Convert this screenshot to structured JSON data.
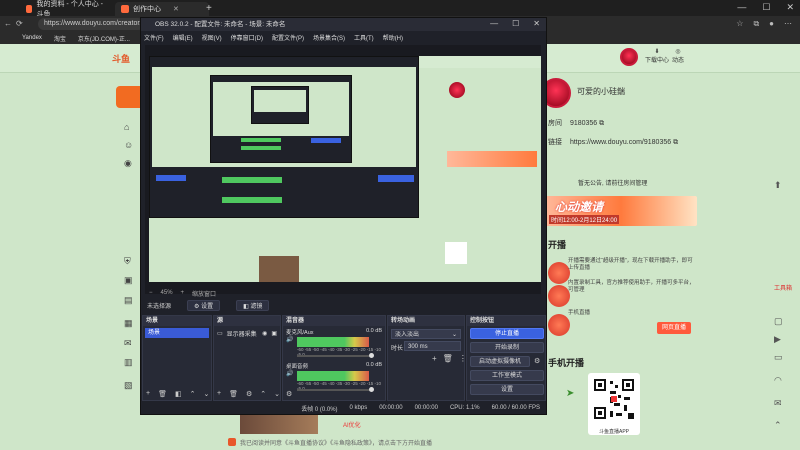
{
  "browser": {
    "tabs": [
      {
        "label": "我的资料 - 个人中心 - 斗鱼",
        "active": false
      },
      {
        "label": "创作中心",
        "active": true
      }
    ],
    "address": "https://www.douyu.com/creator/main/liv",
    "bookmarks": [
      "Yandex",
      "淘宝",
      "京东(JD.COM)-正..."
    ]
  },
  "obs": {
    "title": "OBS 32.0.2 - 配置文件: 未命名 - 场景: 未命名",
    "menu": [
      "文件(F)",
      "编辑(E)",
      "视图(V)",
      "停靠窗口(D)",
      "配置文件(P)",
      "场景集合(S)",
      "工具(T)",
      "帮助(H)"
    ],
    "zoom": "45%",
    "zoom_mode": "缩放窗口",
    "no_source": "未选择源",
    "properties": "设置",
    "filters": "滤镜",
    "docks": {
      "scenes": {
        "title": "场景",
        "items": [
          "场景"
        ]
      },
      "sources": {
        "title": "源",
        "items": [
          "显示器采集"
        ]
      },
      "mixer": {
        "title": "混音器",
        "channels": [
          {
            "name": "麦克风/Aux",
            "db": "0.0 dB"
          },
          {
            "name": "桌面音频",
            "db": "0.0 dB"
          }
        ],
        "ticks": "-60 -55 -50 -45 -40 -35 -30 -25 -20 -15 -10 -5 0"
      },
      "transitions": {
        "title": "转场动画",
        "type": "淡入淡出",
        "duration_label": "时长",
        "duration": "300 ms"
      },
      "controls": {
        "title": "控制按钮",
        "buttons": [
          "停止直播",
          "开始录制",
          "启动虚拟摄像机",
          "工作室模式",
          "设置"
        ]
      }
    },
    "status": {
      "frames": "丢帧 0 (0.0%)",
      "bitrate": "0 kbps",
      "live_time": "00:00:00",
      "rec_time": "00:00:00",
      "cpu": "CPU: 1.1%",
      "fps": "60.00 / 60.00 FPS"
    }
  },
  "site": {
    "logo": "斗鱼",
    "header_right": [
      "下载中心",
      "动态"
    ],
    "profile_name": "可爱的小硅鍴",
    "room_label": "房间",
    "room_id": "9180356",
    "link_label": "链接",
    "room_url": "https://www.douyu.com/9180356",
    "notice": "暂无公告, 请前往房间管理",
    "banner_title": "心动邀请",
    "banner_date": "时间12:00-2月12日24:00",
    "section_start": "开播",
    "p1_title": "如何开播",
    "p1_text": "开播需要通过“超级开播”，现在下载开播助手，即可上传直播",
    "p2_text": "内置录制工具，官方推荐使用助手，开播可多平台，可管理",
    "p3_text": "手机直播",
    "live_btn": "网页直播",
    "section_mobile": "手机开播",
    "qr_label": "斗鱼直播APP",
    "bottom_text": "我已阅读并同意《斗鱼直播协议》《斗鱼隐私政策》，请点击下方开始直播",
    "left_nav_icons": [
      "home-icon",
      "user-icon",
      "location-icon",
      "list-icon",
      "shield-icon",
      "video-icon",
      "chart-icon",
      "grid-icon",
      "mail-icon",
      "doc-icon",
      "cart-icon",
      "gear-icon"
    ],
    "right_icons": [
      "top-icon",
      "app-icon",
      "play-icon",
      "chat-icon",
      "screen-icon",
      "bell-icon",
      "headset-icon",
      "feedback-icon",
      "up-icon"
    ],
    "tools_label": "工具箱"
  }
}
